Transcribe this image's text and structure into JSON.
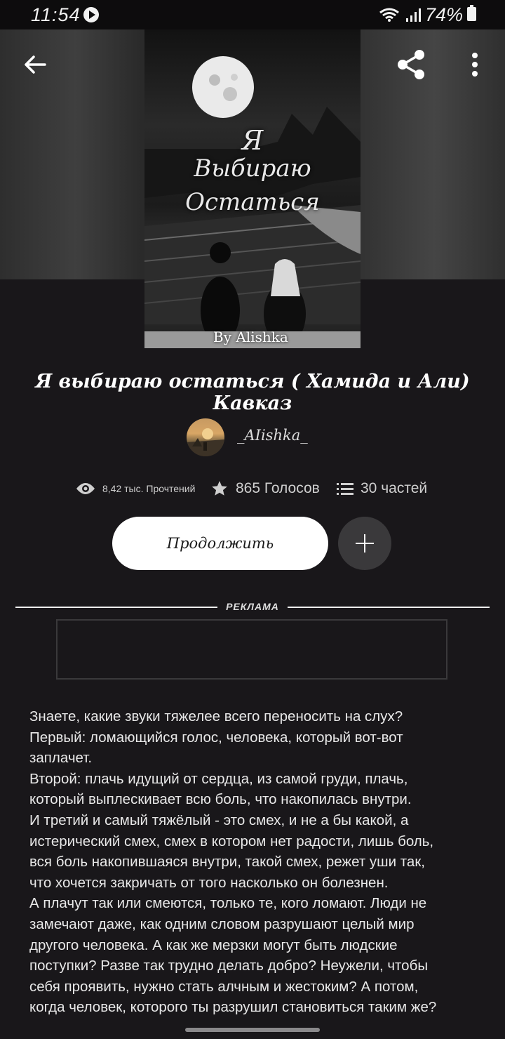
{
  "status_bar": {
    "time": "11:54",
    "battery": "74%"
  },
  "cover": {
    "title_line1": "Я",
    "title_line2": "Выбираю",
    "title_line3": "Остаться",
    "signature": "By Alishka"
  },
  "book": {
    "title": "Я выбираю остаться ( Хамида и Али) Кавказ",
    "author": "_AIishka_",
    "reads": "8,42 тыс. Прочтений",
    "votes": "865 Голосов",
    "parts": "30 частей"
  },
  "actions": {
    "continue_label": "Продолжить"
  },
  "ad": {
    "label": "РЕКЛАМА"
  },
  "story_lines": [
    "Знаете, какие звуки тяжелее всего переносить на слух?",
    "Первый: ломающийся голос, человека, который вот-вот",
    "заплачет.",
    "Второй: плачь идущий от сердца, из самой груди, плачь,",
    "который выплескивает всю боль, что накопилась внутри.",
    "И третий и самый тяжёлый - это смех, и не а бы какой, а",
    "истерический смех, смех в котором нет радости, лишь боль,",
    "вся боль накопившаяся внутри, такой смех, режет уши так,",
    "что хочется закричать от того насколько он болезнен.",
    "А плачут так или смеются, только те, кого ломают. Люди не",
    "замечают даже, как одним словом разрушают целый мир",
    "другого человека. А как же мерзки могут быть людские",
    "поступки? Разве так трудно делать добро? Неужели, чтобы",
    "себя проявить, нужно стать алчным и жестоким? А потом,",
    "когда человек, которого ты разрушил становиться таким же?"
  ]
}
